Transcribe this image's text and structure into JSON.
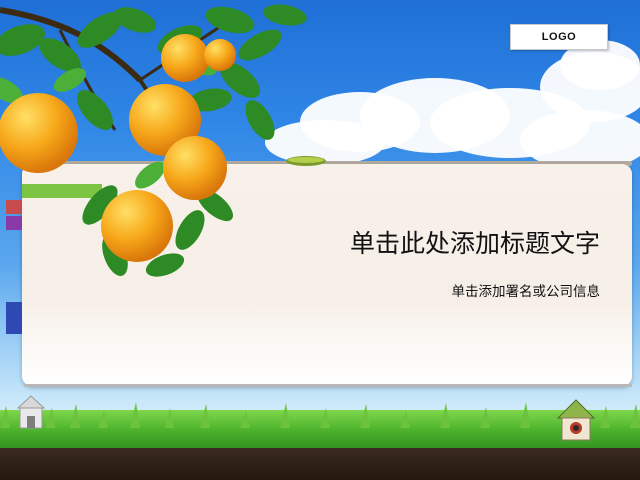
{
  "slide": {
    "logo_text": "LOGO",
    "title": "单击此处添加标题文字",
    "subtitle": "单击添加署名或公司信息"
  },
  "decor": {
    "orange_tree_icon": "orange-tree-branch",
    "left_tabs_colors": [
      "#7cc442",
      "#c94c4c",
      "#8a3aa8",
      "#2f49b2"
    ]
  }
}
